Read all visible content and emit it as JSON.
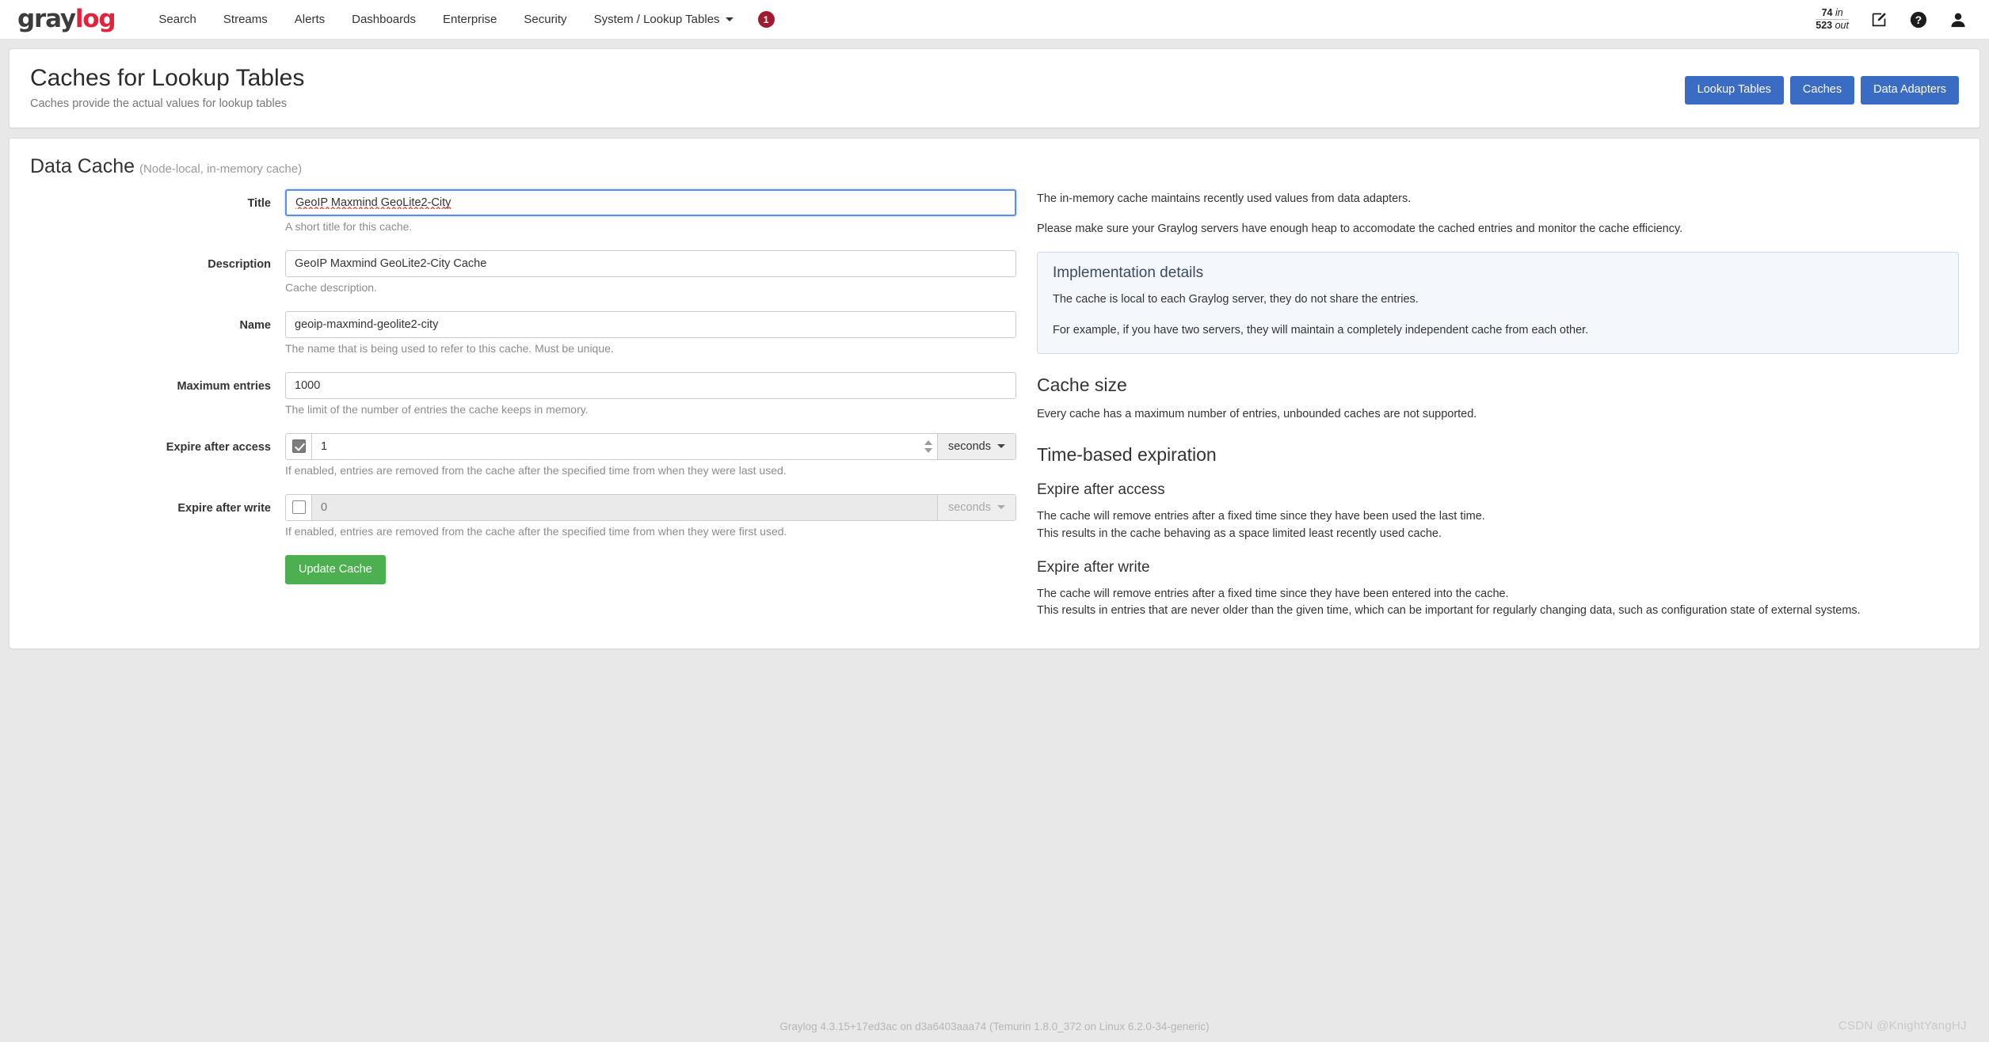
{
  "navbar": {
    "brand_gray": "gray",
    "brand_log": "log",
    "links": [
      {
        "label": "Search",
        "name": "nav-search"
      },
      {
        "label": "Streams",
        "name": "nav-streams"
      },
      {
        "label": "Alerts",
        "name": "nav-alerts"
      },
      {
        "label": "Dashboards",
        "name": "nav-dashboards"
      },
      {
        "label": "Enterprise",
        "name": "nav-enterprise"
      },
      {
        "label": "Security",
        "name": "nav-security"
      },
      {
        "label": "System / Lookup Tables",
        "name": "nav-system-lookup-tables",
        "has_caret": true
      }
    ],
    "badge": "1",
    "badge_color": "#9e1b32",
    "throughput": {
      "in_value": "74",
      "in_label": "in",
      "out_value": "523",
      "out_label": "out"
    },
    "icons": [
      "edit-icon",
      "help-icon",
      "user-icon"
    ]
  },
  "header": {
    "title": "Caches for Lookup Tables",
    "subtitle": "Caches provide the actual values for lookup tables",
    "actions": [
      {
        "label": "Lookup Tables",
        "name": "lookup-tables-button"
      },
      {
        "label": "Caches",
        "name": "caches-button"
      },
      {
        "label": "Data Adapters",
        "name": "data-adapters-button"
      }
    ],
    "accent_color": "#3b6cc4"
  },
  "form": {
    "section_title": "Data Cache",
    "section_note": "(Node-local, in-memory cache)",
    "fields": {
      "title": {
        "label": "Title",
        "value": "GeoIP Maxmind GeoLite2-City",
        "help": "A short title for this cache."
      },
      "description": {
        "label": "Description",
        "value": "GeoIP Maxmind GeoLite2-City Cache",
        "help": "Cache description."
      },
      "name": {
        "label": "Name",
        "value": "geoip-maxmind-geolite2-city",
        "help": "The name that is being used to refer to this cache. Must be unique."
      },
      "max_entries": {
        "label": "Maximum entries",
        "value": "1000",
        "help": "The limit of the number of entries the cache keeps in memory."
      },
      "expire_after_access": {
        "label": "Expire after access",
        "enabled": "true",
        "value": "1",
        "unit": "seconds",
        "help": "If enabled, entries are removed from the cache after the specified time from when they were last used."
      },
      "expire_after_write": {
        "label": "Expire after write",
        "enabled": "false",
        "placeholder": "0",
        "unit": "seconds",
        "help": "If enabled, entries are removed from the cache after the specified time from when they were first used."
      }
    },
    "submit_label": "Update Cache",
    "submit_color": "#4caf50"
  },
  "docs": {
    "intro1": "The in-memory cache maintains recently used values from data adapters.",
    "intro2": "Please make sure your Graylog servers have enough heap to accomodate the cached entries and monitor the cache efficiency.",
    "panel": {
      "title": "Implementation details",
      "line1": "The cache is local to each Graylog server, they do not share the entries.",
      "line2": "For example, if you have two servers, they will maintain a completely independent cache from each other."
    },
    "cache_size": {
      "heading": "Cache size",
      "text": "Every cache has a maximum number of entries, unbounded caches are not supported."
    },
    "expiration": {
      "heading": "Time-based expiration",
      "access": {
        "heading": "Expire after access",
        "line1": "The cache will remove entries after a fixed time since they have been used the last time.",
        "line2": "This results in the cache behaving as a space limited least recently used cache."
      },
      "write": {
        "heading": "Expire after write",
        "line1": "The cache will remove entries after a fixed time since they have been entered into the cache.",
        "line2": "This results in entries that are never older than the given time, which can be important for regularly changing data, such as configuration state of external systems."
      }
    }
  },
  "footer": {
    "text": "Graylog 4.3.15+17ed3ac on d3a6403aaa74 (Temurin 1.8.0_372 on Linux 6.2.0-34-generic)",
    "watermark": "CSDN @KnightYangHJ"
  }
}
